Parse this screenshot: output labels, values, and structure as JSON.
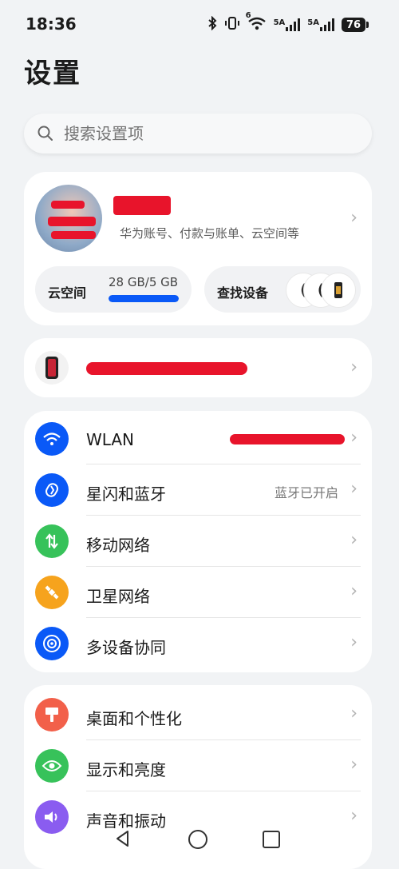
{
  "status": {
    "time": "18:36",
    "net1": "5A",
    "net2": "5A",
    "battery": "76",
    "wifi_badge": "6"
  },
  "page": {
    "title": "设置"
  },
  "search": {
    "placeholder": "搜索设置项"
  },
  "account": {
    "subtitle": "华为账号、付款与账单、云空间等"
  },
  "cloud": {
    "label": "云空间",
    "usage": "28 GB/5 GB",
    "fill_fraction": 1.0
  },
  "find_device": {
    "label": "查找设备"
  },
  "network": {
    "items": [
      {
        "label": "WLAN",
        "value": "",
        "icon": "wifi-icon",
        "color": "#0a59f7"
      },
      {
        "label": "星闪和蓝牙",
        "value": "蓝牙已开启",
        "icon": "bluetooth-icon",
        "color": "#0a59f7"
      },
      {
        "label": "移动网络",
        "value": "",
        "icon": "mobile-data-icon",
        "color": "#37c25a"
      },
      {
        "label": "卫星网络",
        "value": "",
        "icon": "satellite-icon",
        "color": "#f6a31d"
      },
      {
        "label": "多设备协同",
        "value": "",
        "icon": "multi-device-icon",
        "color": "#0a59f7"
      }
    ]
  },
  "display": {
    "items": [
      {
        "label": "桌面和个性化",
        "icon": "paintbrush-icon",
        "color": "#f2604a"
      },
      {
        "label": "显示和亮度",
        "icon": "eye-icon",
        "color": "#37c25a"
      },
      {
        "label": "声音和振动",
        "icon": "speaker-icon",
        "color": "#8a5cf0"
      }
    ]
  },
  "colors": {
    "accent": "#0a59f7",
    "redaction": "#e8142b"
  }
}
